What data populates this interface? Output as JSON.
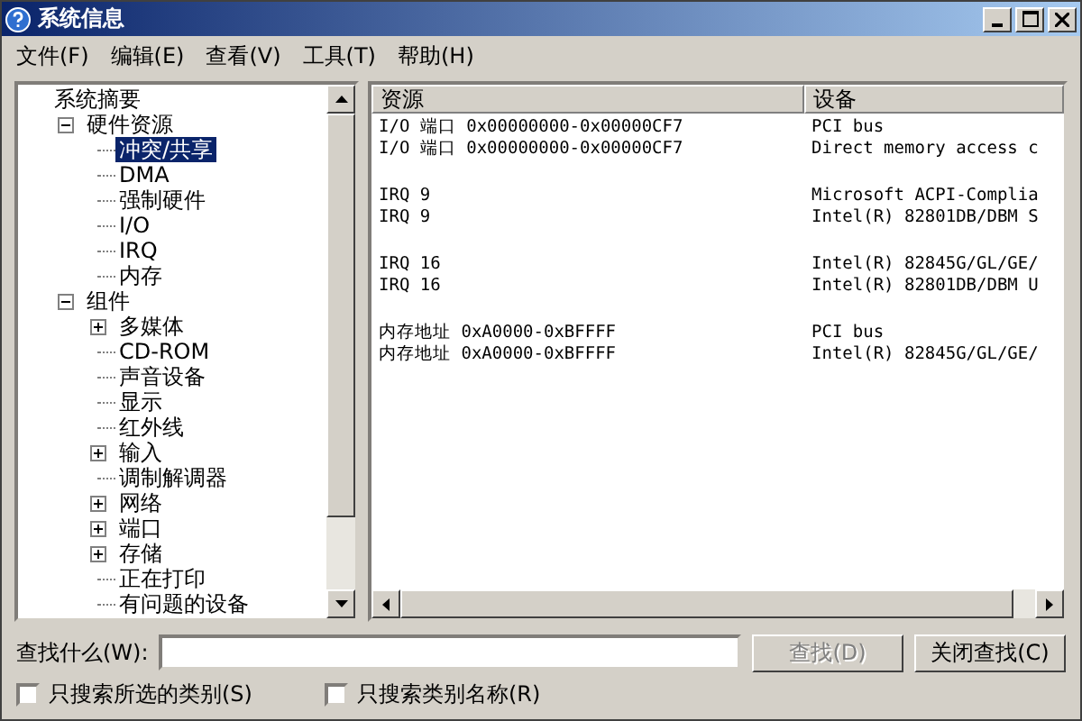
{
  "window": {
    "title": "系统信息"
  },
  "menu": [
    "文件(F)",
    "编辑(E)",
    "查看(V)",
    "工具(T)",
    "帮助(H)"
  ],
  "tree": [
    {
      "label": "系统摘要",
      "selected": false,
      "children": [
        {
          "label": "硬件资源",
          "selected": false,
          "expanded": true,
          "children": [
            {
              "label": "冲突/共享",
              "selected": true
            },
            {
              "label": "DMA",
              "selected": false
            },
            {
              "label": "强制硬件",
              "selected": false
            },
            {
              "label": "I/O",
              "selected": false
            },
            {
              "label": "IRQ",
              "selected": false
            },
            {
              "label": "内存",
              "selected": false
            }
          ]
        },
        {
          "label": "组件",
          "selected": false,
          "expanded": true,
          "children": [
            {
              "label": "多媒体",
              "selected": false,
              "expanded": false
            },
            {
              "label": "CD-ROM",
              "selected": false
            },
            {
              "label": "声音设备",
              "selected": false
            },
            {
              "label": "显示",
              "selected": false
            },
            {
              "label": "红外线",
              "selected": false
            },
            {
              "label": "输入",
              "selected": false,
              "expanded": false
            },
            {
              "label": "调制解调器",
              "selected": false
            },
            {
              "label": "网络",
              "selected": false,
              "expanded": false
            },
            {
              "label": "端口",
              "selected": false,
              "expanded": false
            },
            {
              "label": "存储",
              "selected": false,
              "expanded": false
            },
            {
              "label": "正在打印",
              "selected": false
            },
            {
              "label": "有问题的设备",
              "selected": false
            }
          ]
        }
      ]
    }
  ],
  "table": {
    "columns": [
      "资源",
      "设备"
    ],
    "groups": [
      [
        [
          "I/O 端口 0x00000000-0x00000CF7",
          "PCI bus"
        ],
        [
          "I/O 端口 0x00000000-0x00000CF7",
          "Direct memory access c"
        ]
      ],
      [
        [
          "IRQ 9",
          "Microsoft ACPI-Complia"
        ],
        [
          "IRQ 9",
          "Intel(R) 82801DB/DBM S"
        ]
      ],
      [
        [
          "IRQ 16",
          "Intel(R) 82845G/GL/GE/"
        ],
        [
          "IRQ 16",
          "Intel(R) 82801DB/DBM U"
        ]
      ],
      [
        [
          "内存地址 0xA0000-0xBFFFF",
          "PCI bus"
        ],
        [
          "内存地址 0xA0000-0xBFFFF",
          "Intel(R) 82845G/GL/GE/"
        ]
      ]
    ]
  },
  "find": {
    "label": "查找什么(W):",
    "find_button": {
      "label": "查找(D)",
      "disabled": true
    },
    "close_button": {
      "label": "关闭查找(C)",
      "disabled": false
    }
  },
  "options": [
    {
      "label": "只搜索所选的类别(S)",
      "checked": false
    },
    {
      "label": "只搜索类别名称(R)",
      "checked": false
    }
  ]
}
